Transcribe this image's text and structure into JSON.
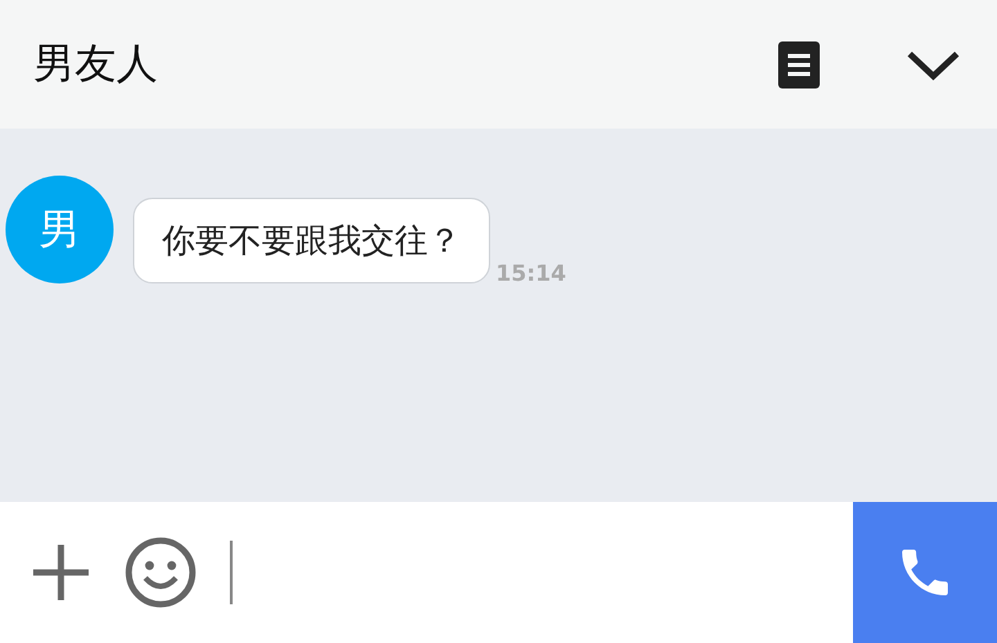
{
  "header": {
    "title": "男友人"
  },
  "messages": [
    {
      "avatar": "男",
      "text": "你要不要跟我交往？",
      "time": "15:14"
    }
  ]
}
